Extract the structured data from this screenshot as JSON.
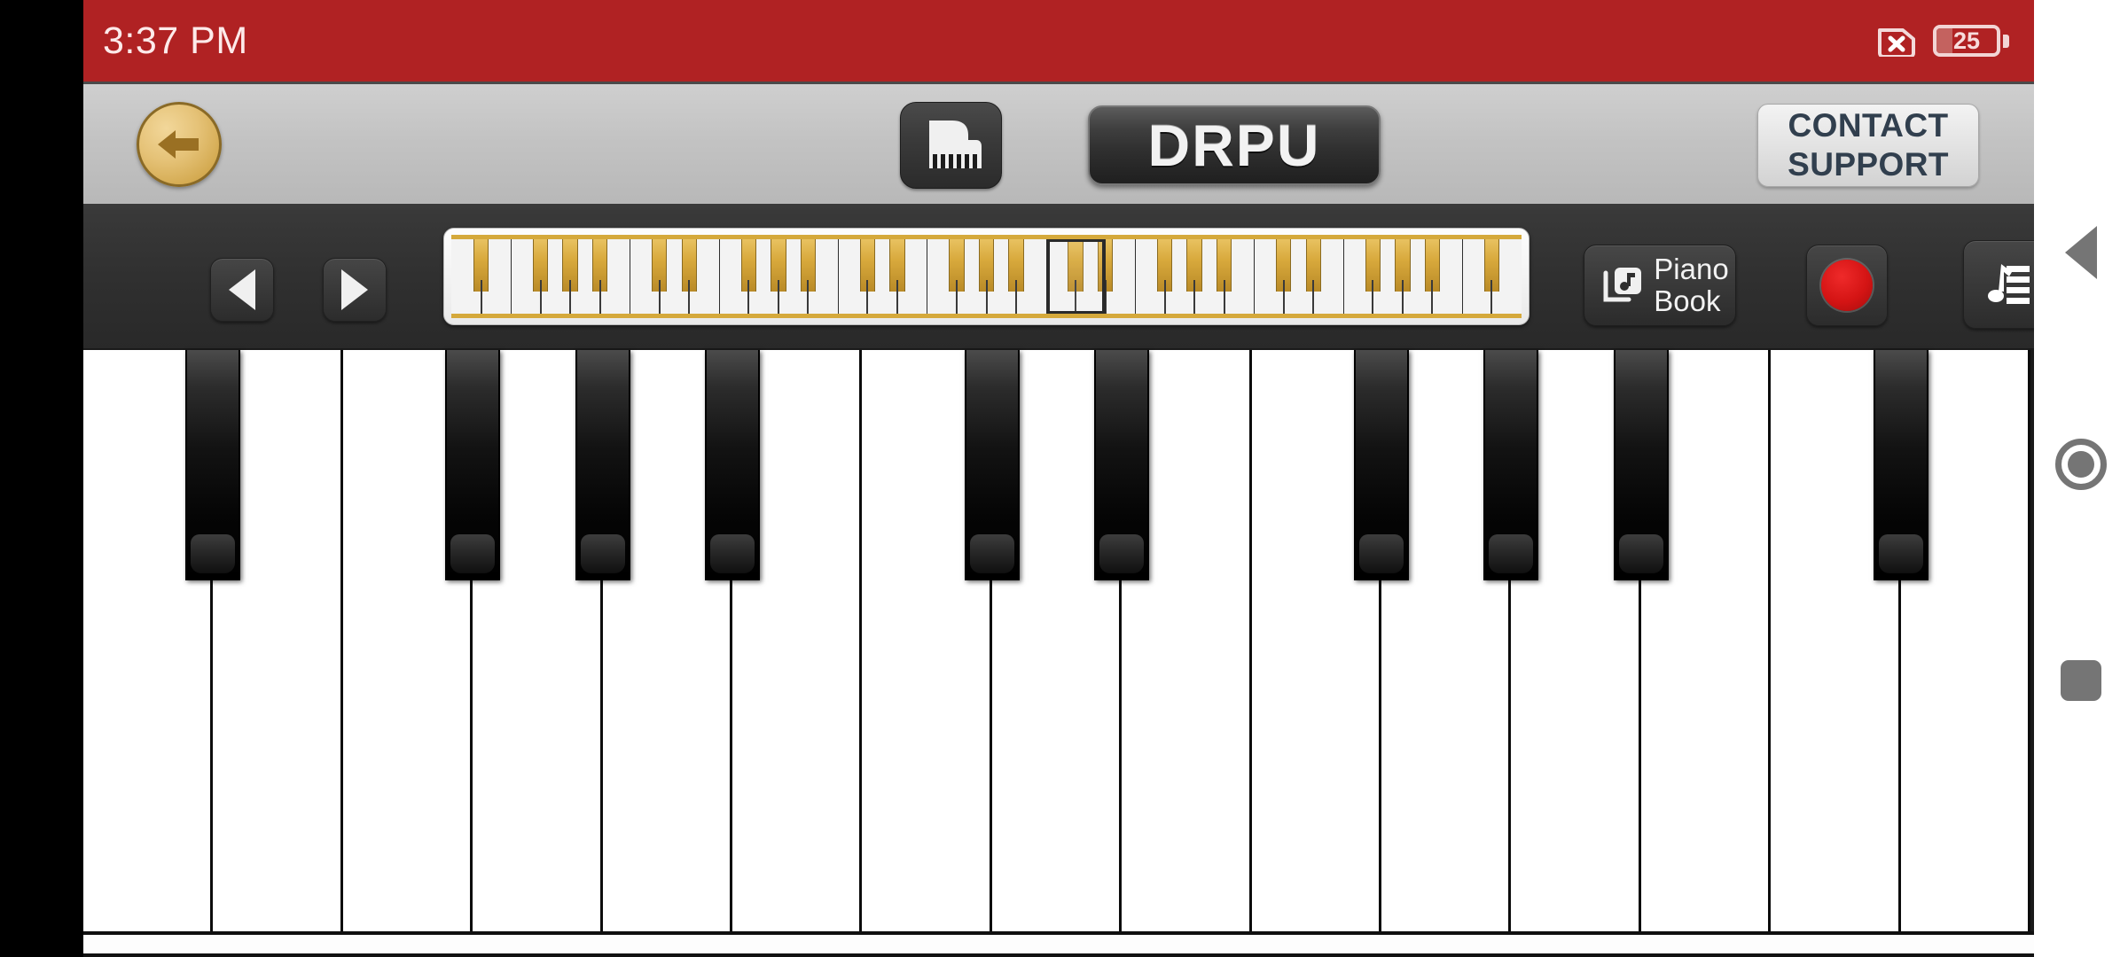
{
  "status_bar": {
    "time": "3:37 PM",
    "sim_icon": "no-sim-icon",
    "battery_icon": "battery-icon",
    "battery_level": "25",
    "background_color": "#b02223"
  },
  "app_header": {
    "back_icon": "back-arrow-icon",
    "app_icon": "grand-piano-icon",
    "brand": "DRPU",
    "contact_line1": "CONTACT",
    "contact_line2": "SUPPORT"
  },
  "toolbar": {
    "prev_icon": "triangle-left-icon",
    "next_icon": "triangle-right-icon",
    "piano_book_line1": "Piano",
    "piano_book_line2": "Book",
    "piano_book_icon": "music-book-icon",
    "record_icon": "record-circle-icon",
    "sheet_icon": "sheet-music-icon",
    "accent_gold": "#d5a93b",
    "record_color": "#d41414"
  },
  "mini_keyboard": {
    "white_key_count": 36,
    "selection_start_index": 20,
    "selection_width_keys": 2
  },
  "keyboard": {
    "white_key_count": 15,
    "black_key_pattern": [
      1,
      0,
      1,
      1,
      1,
      0,
      1,
      1,
      0,
      1,
      1,
      1,
      0,
      1
    ],
    "white_key_color": "#ffffff",
    "black_key_color": "#050505"
  },
  "navigation_bar": {
    "back_icon": "nav-back-triangle-icon",
    "home_icon": "nav-home-circle-icon",
    "recents_icon": "nav-recents-square-icon",
    "icon_color": "#757575"
  }
}
